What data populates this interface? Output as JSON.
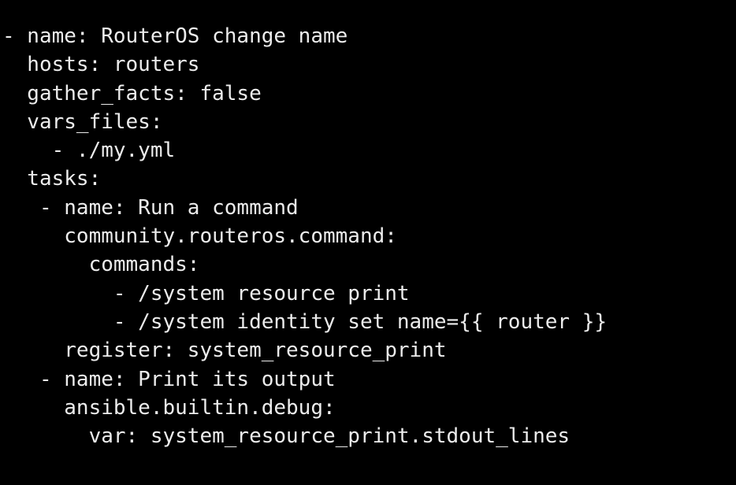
{
  "editor": {
    "background_color": "#000000",
    "text_color": "#ececec",
    "lines": [
      "- name: RouterOS change name",
      "  hosts: routers",
      "  gather_facts: false",
      "  vars_files:",
      "    - ./my.yml",
      "  tasks:",
      "   - name: Run a command",
      "     community.routeros.command:",
      "       commands:",
      "         - /system resource print",
      "         - /system identity set name={{ router }}",
      "     register: system_resource_print",
      "   - name: Print its output",
      "     ansible.builtin.debug:",
      "       var: system_resource_print.stdout_lines"
    ]
  }
}
